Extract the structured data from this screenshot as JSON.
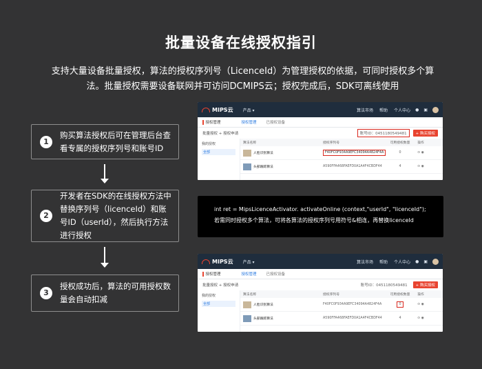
{
  "title": "批量设备在线授权指引",
  "intro_line1": "支持大量设备批量授权，算法的授权序列号（LicenceId）为管理授权的依据，可同时授权多个算",
  "intro_line2": "法。批量授权需要设备联网并可访问DCMIPS云；授权完成后，SDK可离线使用",
  "steps": [
    {
      "num": "1",
      "text": "购买算法授权后可在管理后台查看专属的授权序列号和账号ID"
    },
    {
      "num": "2",
      "text": "开发者在SDK的在线授权方法中替换序列号（licenceId）和账号ID（userId），然后执行方法进行授权"
    },
    {
      "num": "3",
      "text": "授权成功后，算法的可用授权数量会自动扣减"
    }
  ],
  "code": {
    "line1": "int ret = MipsLicenceActivator. activateOnline (context,\"userId\", \"licenceId\");",
    "line2": "若需同时授权多个算法，可将各算法的授权序列号用符号&相连，再替换licenceId"
  },
  "screenshot": {
    "brand": "MIPS云",
    "nav_menu": "产品 ▾",
    "nav_links": [
      "算法市场",
      "帮助",
      "个人中心"
    ],
    "nav_icons": [
      "bell-icon",
      "cart-icon"
    ],
    "breadcrumb": "授权管理",
    "tab_active": "授权管理",
    "tab_other": "已授权设备",
    "toolbar_left": "批量授权  + 授权申请",
    "serial_label": "账号ID：0451180549481",
    "buy_button": "+ 购买授权",
    "side_group": "我的授权",
    "side_selected": "全部",
    "columns": [
      "算法名称",
      "授权序列号",
      "可用授权数量",
      "操作"
    ],
    "rows": [
      {
        "name": "人脸识别算法",
        "serial": "F40FC0F934A9EFC34094A4824F4A",
        "count": "0",
        "op": "⊙ ◉"
      },
      {
        "name": "头部跟踪算法",
        "serial": "A590FFA468FAEFD0A1A4F4CBDF44",
        "count": "4",
        "op": "⊙ ◉"
      }
    ]
  }
}
